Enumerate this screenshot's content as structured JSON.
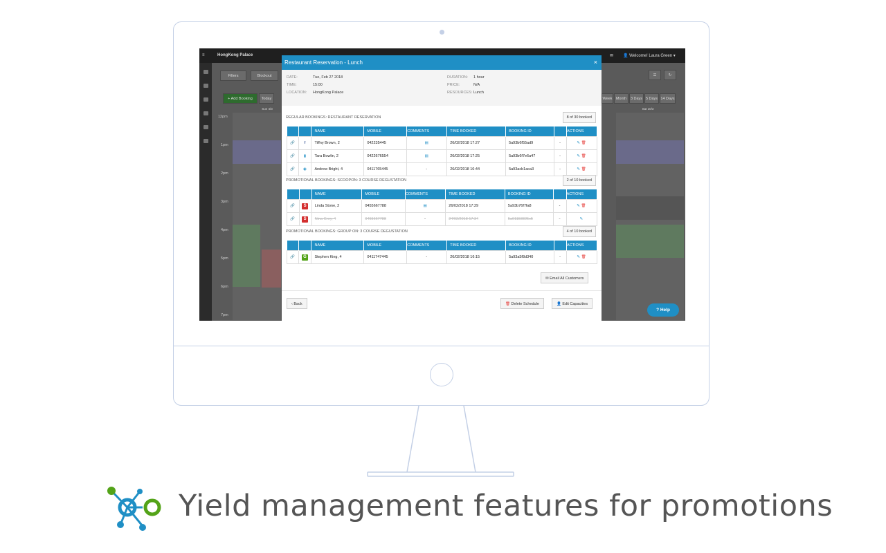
{
  "app": {
    "venue": "HongKong Palace",
    "welcome": "Welcome! Laura Green",
    "filters_label": "Filters",
    "blockout_label": "Blockout",
    "add_booking_label": "+ Add Booking",
    "today_label": "Today",
    "day_left": "Sun 4/3",
    "day_right": "Sat 10/3",
    "view_tabs": [
      "Week",
      "Month",
      "3 Days",
      "5 Days",
      "14 Days"
    ],
    "hours": [
      "12pm",
      "1pm",
      "2pm",
      "3pm",
      "4pm",
      "5pm",
      "6pm",
      "7pm"
    ],
    "help_label": "Help"
  },
  "modal": {
    "title": "Restaurant Reservation - Lunch",
    "close": "×",
    "date_label": "DATE:",
    "date": "Tue, Feb 27 2018",
    "time_label": "TIME:",
    "time": "15:00",
    "location_label": "LOCATION:",
    "location": "HongKong Palace",
    "duration_label": "DURATION:",
    "duration": "1 hour",
    "price_label": "PRICE:",
    "price": "N/A",
    "resources_label": "RESOURCES:",
    "resources": "Lunch",
    "columns": [
      "NAME",
      "MOBILE",
      "COMMENTS",
      "TIME BOOKED",
      "BOOKING ID",
      "ACTIONS"
    ],
    "sections": [
      {
        "title": "REGULAR BOOKINGS: RESTAURANT RESERVATION",
        "count": "8 of 30 booked",
        "rows": [
          {
            "source": "facebook",
            "name": "Tiffny Brown, 2",
            "mobile": "042235445",
            "comments": "comment-icon",
            "time": "26/02/2018 17:27",
            "id": "5a93b6f55ad9",
            "dash": "-"
          },
          {
            "source": "web",
            "name": "Tara Bowlin, 2",
            "mobile": "0422676554",
            "comments": "comment-icon",
            "time": "26/02/2018 17:25",
            "id": "5a93b6f7e6a47",
            "dash": "-"
          },
          {
            "source": "tripadvisor",
            "name": "Andrew Bright, 4",
            "mobile": "0411765445",
            "comments": "-",
            "time": "26/02/2018 16:44",
            "id": "5a93acb1aca3",
            "dash": "-"
          }
        ]
      },
      {
        "title": "PROMOTIONAL BOOKINGS: SCOOPON: 3 COURSE DEGUSTATION",
        "count": "2 of 10 booked",
        "rows": [
          {
            "source": "scoopon",
            "name": "Linda Stone, 2",
            "mobile": "0455667788",
            "comments": "comment-icon",
            "time": "26/02/2018 17:29",
            "id": "5a93b76f7fa8",
            "dash": "-"
          },
          {
            "source": "scoopon",
            "name": "Nina Grey, 4",
            "mobile": "0455667788",
            "comments": "-",
            "time": "24/02/2018 17:34",
            "id": "5a91158825c5",
            "dash": "-",
            "cancelled": true
          }
        ]
      },
      {
        "title": "PROMOTIONAL BOOKINGS: GROUP ON: 3 COURSE DEGUSTATION",
        "count": "4 of 10 booked",
        "rows": [
          {
            "source": "groupon",
            "name": "Stephen King, 4",
            "mobile": "0411747445",
            "comments": "-",
            "time": "26/02/2018 16:15",
            "id": "5a93a5f8d340",
            "dash": "-"
          }
        ]
      }
    ],
    "email_all": "Email All Customers",
    "back": "Back",
    "delete_schedule": "Delete Schedule",
    "edit_capacities": "Edit Capacities"
  },
  "tagline": "Yield management features for promotions",
  "colors": {
    "accent": "#1f8fc5",
    "danger": "#e53935",
    "groupon": "#53a318",
    "scoopon": "#d32f2f"
  }
}
